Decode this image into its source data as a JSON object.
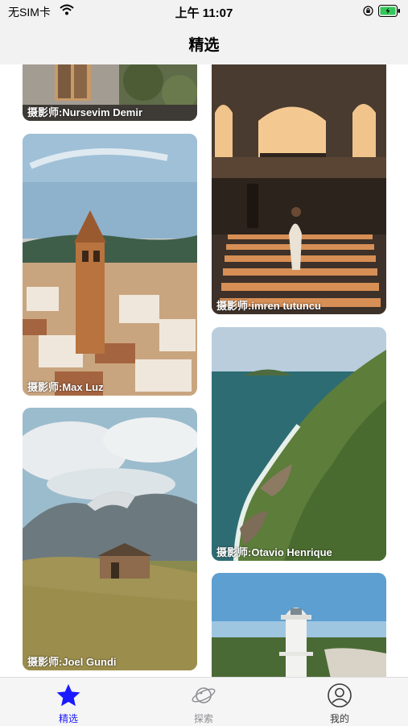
{
  "status_bar": {
    "carrier": "无SIM卡",
    "time": "上午 11:07"
  },
  "nav": {
    "title": "精选"
  },
  "photos": [
    {
      "caption": "摄影师:Nursevim Demir"
    },
    {
      "caption": "摄影师:imren tutuncu"
    },
    {
      "caption": "摄影师:Max Luz"
    },
    {
      "caption": "摄影师:Otavio Henrique"
    },
    {
      "caption": "摄影师:Joel Gundi"
    },
    {
      "caption": ""
    }
  ],
  "tabs": [
    {
      "label": "精选",
      "icon": "star-icon",
      "selected": true
    },
    {
      "label": "探索",
      "icon": "planet-icon",
      "selected": false
    },
    {
      "label": "我的",
      "icon": "profile-icon",
      "selected": false
    }
  ],
  "colors": {
    "accent": "#1a1aff",
    "inactive": "#8e8e93"
  }
}
